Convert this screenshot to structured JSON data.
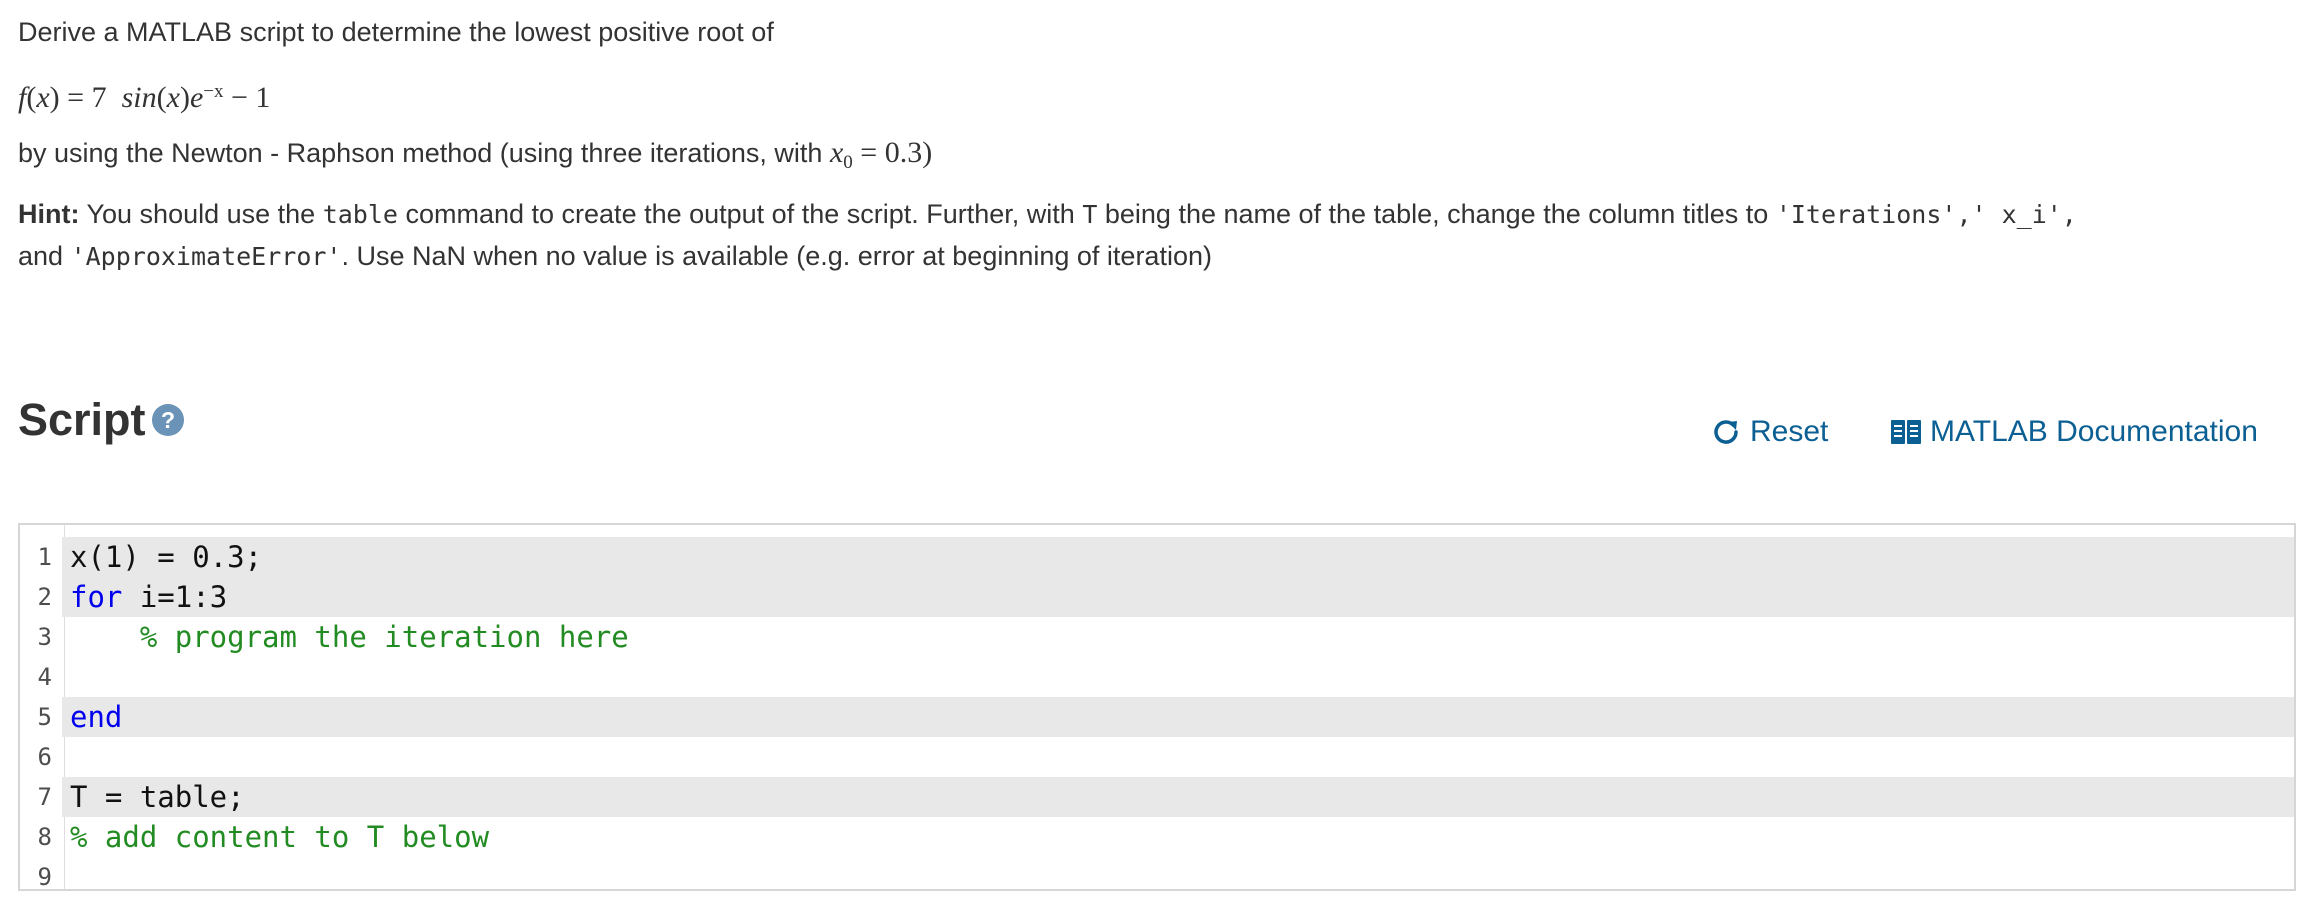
{
  "problem": {
    "intro": "Derive a MATLAB script to determine the lowest positive root of",
    "equation": {
      "lhs": "f(x) = 7",
      "func": "sin(x)e",
      "exponent": "−x",
      "tail": "− 1"
    },
    "method_text": "by using the Newton - Raphson method (using three iterations, with",
    "initial": {
      "var": "x",
      "sub": "0",
      "value": "= 0.3)"
    },
    "hint_label": "Hint:",
    "hint_1": " You should use the ",
    "hint_code_table": "table",
    "hint_2": "  command to create the output of the script. Further, with ",
    "hint_code_T": "T",
    "hint_3": " being the name of the table, change the column titles to ",
    "hint_code_titles": "'Iterations',' x_i',",
    "hint_4": "and ",
    "hint_code_err": "'ApproximateError'",
    "hint_5": ". Use NaN when no value is available (e.g. error at beginning of iteration)"
  },
  "script_section": {
    "title": "Script",
    "help_icon": "?",
    "reset_label": "Reset",
    "docs_label": "MATLAB Documentation"
  },
  "editor": {
    "lines": [
      {
        "number": "1",
        "text": "x(1) = 0.3;",
        "highlight": true
      },
      {
        "number": "2",
        "kw": "for",
        "text": " i=1:3",
        "highlight": true
      },
      {
        "number": "3",
        "comment": "    % program the iteration here",
        "highlight": false
      },
      {
        "number": "4",
        "text": "",
        "highlight": false
      },
      {
        "number": "5",
        "kw": "end",
        "text": "",
        "highlight": true
      },
      {
        "number": "6",
        "text": "",
        "highlight": false
      },
      {
        "number": "7",
        "text": "T = table;",
        "highlight": true
      },
      {
        "number": "8",
        "comment": "% add content to T below",
        "highlight": false
      },
      {
        "number": "9",
        "text": "",
        "highlight": false
      }
    ]
  },
  "colors": {
    "link": "#0b5f93",
    "keyword": "#0000ee",
    "comment": "#228b22",
    "highlight_line": "#e8e8e8",
    "help_icon_bg": "#6b93b8"
  }
}
